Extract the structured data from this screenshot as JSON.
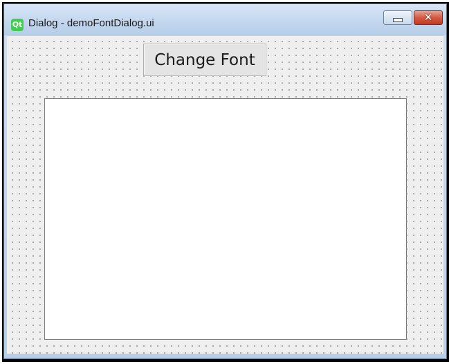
{
  "window": {
    "title": "Dialog - demoFontDialog.ui",
    "app_icon": "qt-icon",
    "minimize_icon": "minimize-icon",
    "close_icon": "close-icon",
    "close_glyph": "✕",
    "app_icon_glyph": "Qt"
  },
  "dialog": {
    "change_font_label": "Change Font",
    "text_edit_value": ""
  },
  "colors": {
    "client_background": "#efefef",
    "close_button": "#c23a1f",
    "qt_green": "#41cd52"
  }
}
